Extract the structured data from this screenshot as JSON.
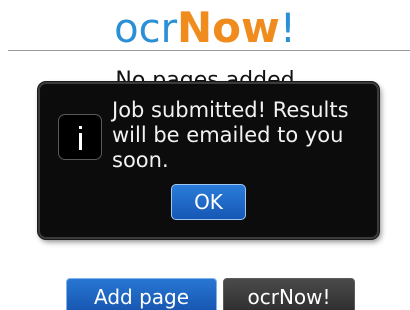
{
  "header": {
    "logo_part_ocr": "ocr",
    "logo_part_now": "Now",
    "logo_part_bang": "!"
  },
  "main": {
    "status_text": "No pages added"
  },
  "dialog": {
    "icon": "info-icon",
    "message": "Job submitted! Results will be emailed to you soon.",
    "ok_label": "OK"
  },
  "actions": {
    "add_page_label": "Add page",
    "ocr_now_label": "ocrNow!"
  },
  "colors": {
    "logo_blue": "#2a8fd6",
    "logo_orange": "#f08c1e",
    "button_blue": "#1f66c4",
    "dialog_bg": "#0c0c0c"
  }
}
